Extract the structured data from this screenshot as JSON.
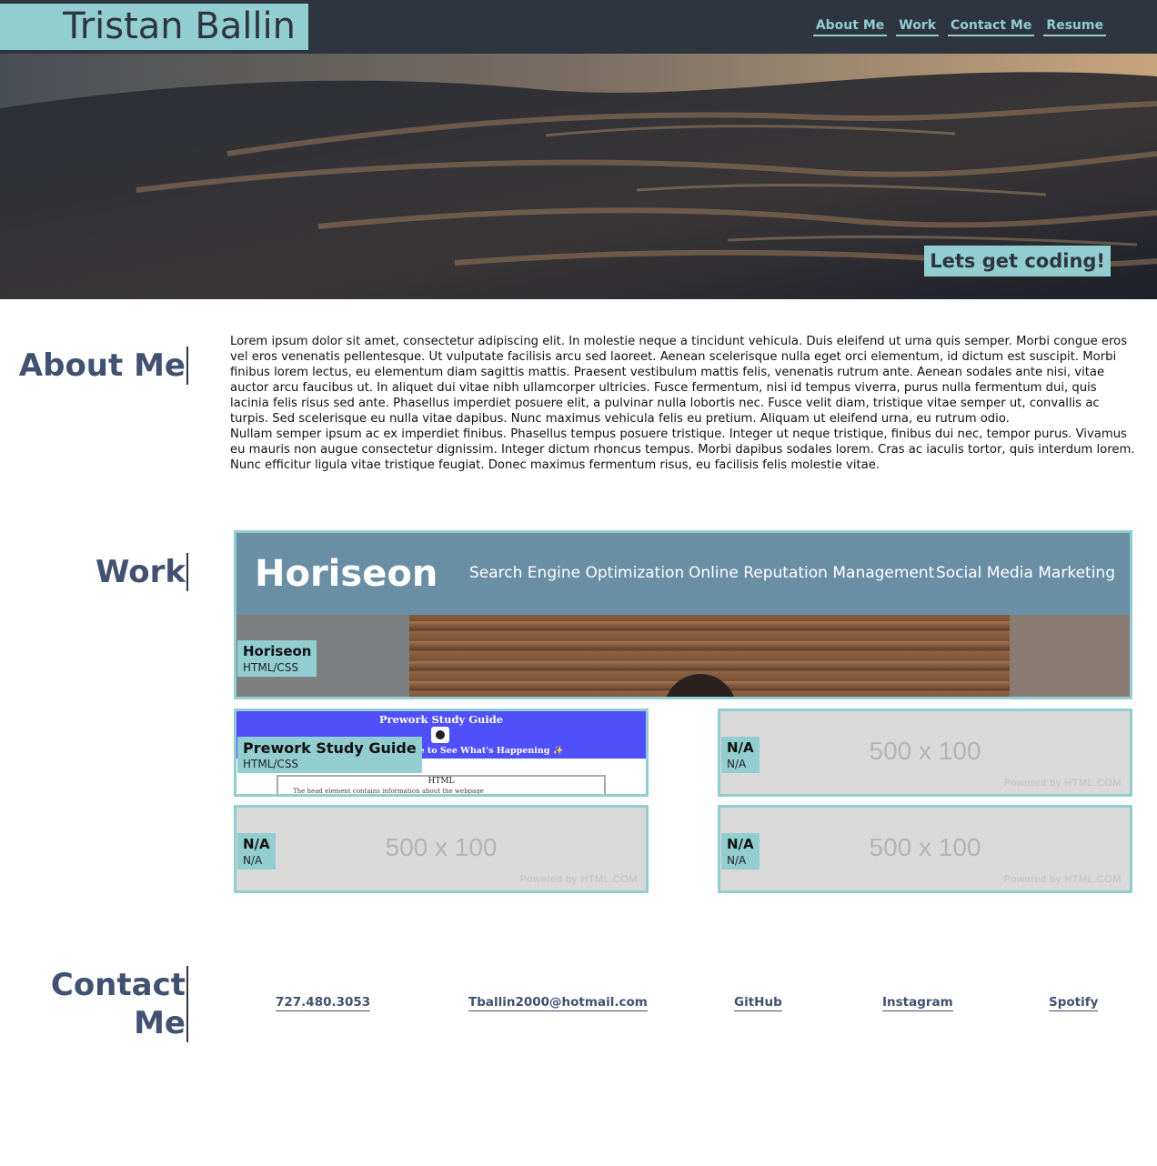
{
  "header": {
    "name": "Tristan Ballin",
    "nav": [
      "About Me",
      "Work",
      "Contact Me",
      "Resume"
    ]
  },
  "hero": {
    "tagline": "Lets get coding!"
  },
  "about": {
    "title": "About Me",
    "paragraphs": [
      "Lorem ipsum dolor sit amet, consectetur adipiscing elit. In molestie neque a tincidunt vehicula. Duis eleifend ut urna quis semper. Morbi congue eros vel eros venenatis pellentesque. Ut vulputate facilisis arcu sed laoreet. Aenean scelerisque nulla eget orci elementum, id dictum est suscipit. Morbi finibus lorem lectus, eu elementum diam sagittis mattis. Praesent vestibulum mattis felis, venenatis rutrum ante. Aenean sodales ante nisi, vitae auctor arcu faucibus ut. In aliquet dui vitae nibh ullamcorper ultricies. Fusce fermentum, nisi id tempus viverra, purus nulla fermentum dui, quis lacinia felis risus sed ante. Phasellus imperdiet posuere elit, a pulvinar nulla lobortis nec. Fusce velit diam, tristique vitae semper ut, convallis ac turpis. Sed scelerisque eu nulla vitae dapibus. Nunc maximus vehicula felis eu pretium. Aliquam ut eleifend urna, eu rutrum odio.",
      "Nullam semper ipsum ac ex imperdiet finibus. Phasellus tempus posuere tristique. Integer ut neque tristique, finibus dui nec, tempor purus. Vivamus eu mauris non augue consectetur dignissim. Integer dictum rhoncus tempus. Morbi dapibus sodales lorem. Cras ac iaculis tortor, quis interdum lorem. Nunc efficitur ligula vitae tristique feugiat. Donec maximus fermentum risus, eu facilisis felis molestie vitae."
    ]
  },
  "work": {
    "title": "Work",
    "featured": {
      "title": "Horiseon",
      "subtitle": "HTML/CSS",
      "screenshot": {
        "logo": "Horiseon",
        "nav": [
          "Search Engine Optimization",
          "Online Reputation Management",
          "Social Media Marketing"
        ]
      }
    },
    "prework": {
      "title": "Prework Study Guide",
      "subtitle": "HTML/CSS",
      "screenshot": {
        "heading": "Prework Study Guide",
        "subheading": "onsole to See What's Happening ✨",
        "section": "HTML",
        "bullet": "The head element contains information about the webpage"
      }
    },
    "placeholders": [
      {
        "title": "N/A",
        "subtitle": "N/A",
        "dims": "500 x 100",
        "powered": "Powered by HTML.COM"
      },
      {
        "title": "N/A",
        "subtitle": "N/A",
        "dims": "500 x 100",
        "powered": "Powered by HTML.COM"
      },
      {
        "title": "N/A",
        "subtitle": "N/A",
        "dims": "500 x 100",
        "powered": "Powered by HTML.COM"
      }
    ]
  },
  "contact": {
    "title_line1": "Contact",
    "title_line2": "Me",
    "links": [
      "727.480.3053",
      "Tballin2000@hotmail.com",
      "GitHub",
      "Instagram",
      "Spotify"
    ]
  },
  "colors": {
    "accent": "#92cdd1",
    "header_bg": "#2e353f",
    "heading": "#415171"
  }
}
